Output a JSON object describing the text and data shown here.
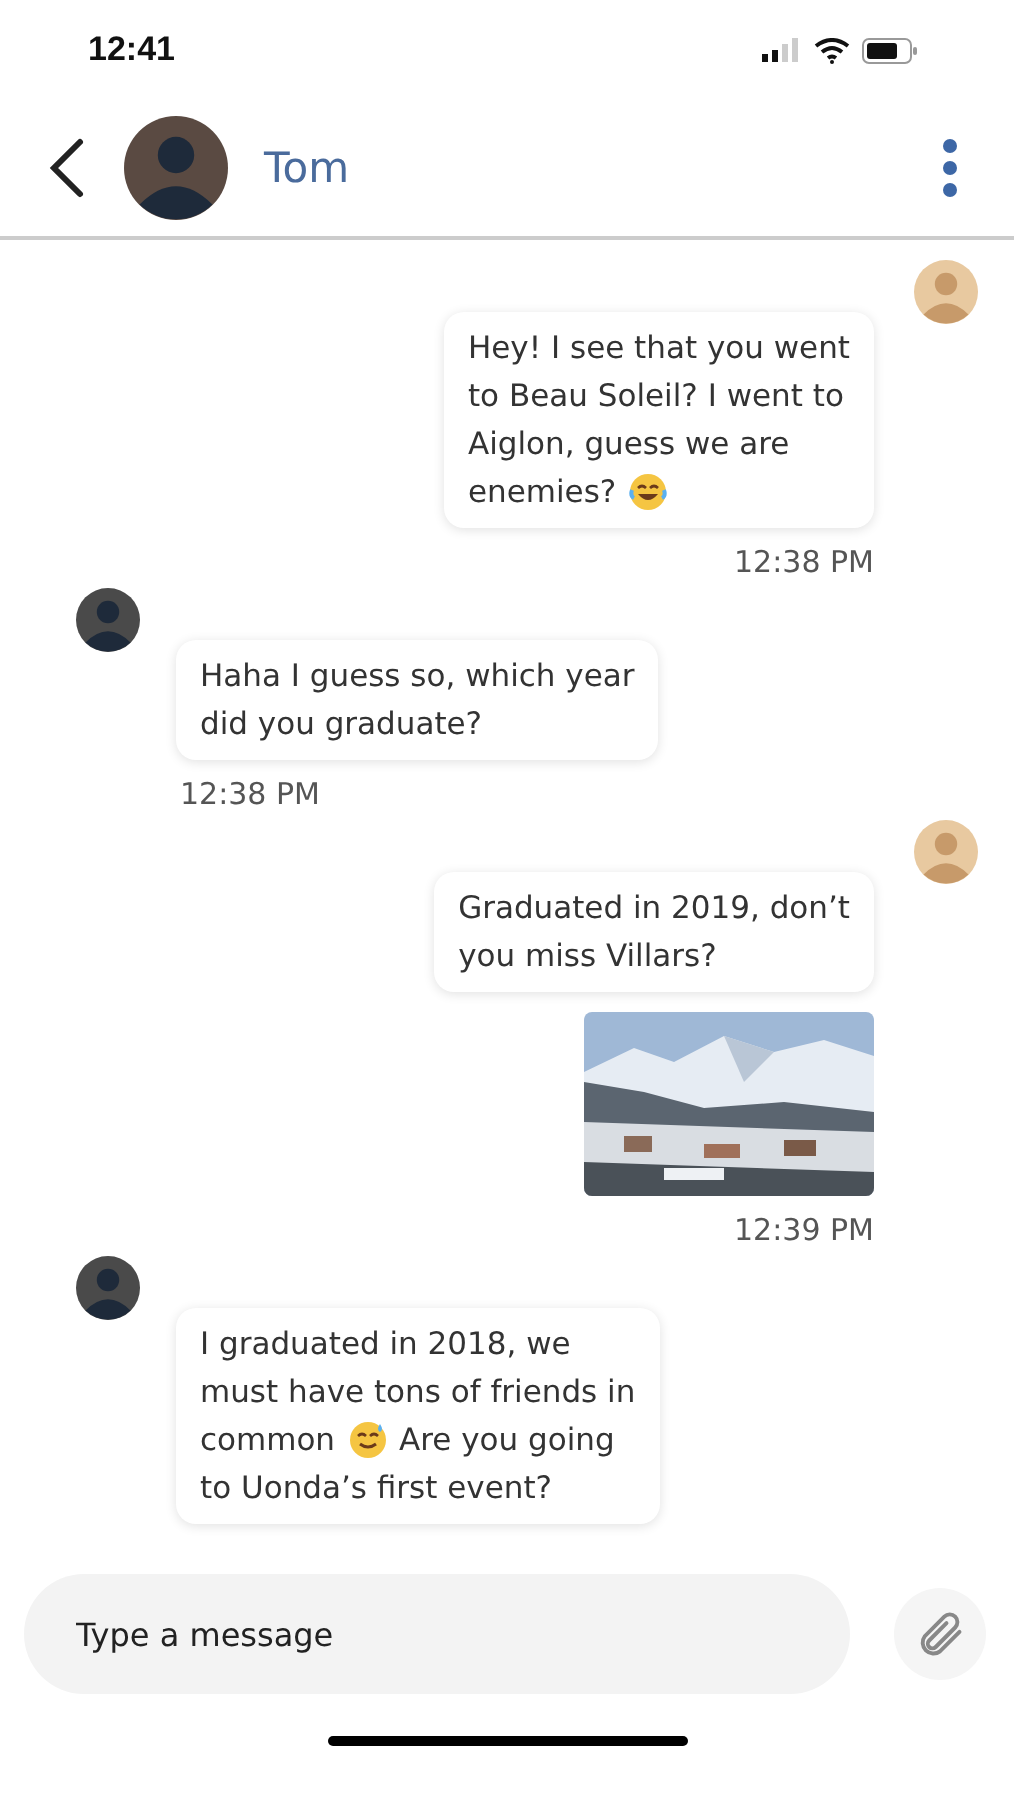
{
  "status_bar": {
    "time": "12:41"
  },
  "header": {
    "contact_name": "Tom"
  },
  "messages": [
    {
      "kind": "outgoing",
      "lines": [
        [
          {
            "kind": "text",
            "text": "Hey! I see that you went"
          }
        ],
        [
          {
            "kind": "text",
            "text": "to Beau Soleil? I went to"
          }
        ],
        [
          {
            "kind": "text",
            "text": "Aiglon, guess we are"
          }
        ],
        [
          {
            "kind": "text",
            "text": "enemies?"
          },
          {
            "kind": "laugh"
          }
        ]
      ],
      "time": "12:38 PM"
    },
    {
      "kind": "incoming",
      "lines": [
        [
          {
            "kind": "text",
            "text": "Haha I guess so, which year"
          }
        ],
        [
          {
            "kind": "text",
            "text": "did you graduate?"
          }
        ]
      ],
      "time": "12:38 PM"
    },
    {
      "kind": "outgoing",
      "lines": [
        [
          {
            "kind": "text",
            "text": "Graduated in 2019, don’t"
          }
        ],
        [
          {
            "kind": "text",
            "text": "you miss Villars?"
          }
        ]
      ],
      "attachment": {
        "kind": "picture"
      },
      "time": "12:39 PM"
    },
    {
      "kind": "incoming",
      "lines": [
        [
          {
            "kind": "text",
            "text": "I graduated in 2018, we"
          }
        ],
        [
          {
            "kind": "text",
            "text": "must have tons of friends in"
          }
        ],
        [
          {
            "kind": "text",
            "text": "common"
          },
          {
            "kind": "sweat"
          },
          {
            "kind": "text",
            "text": "Are you going"
          }
        ],
        [
          {
            "kind": "text",
            "text": "to Uonda’s first event?"
          }
        ]
      ]
    }
  ],
  "composer": {
    "placeholder": "Type a message"
  }
}
